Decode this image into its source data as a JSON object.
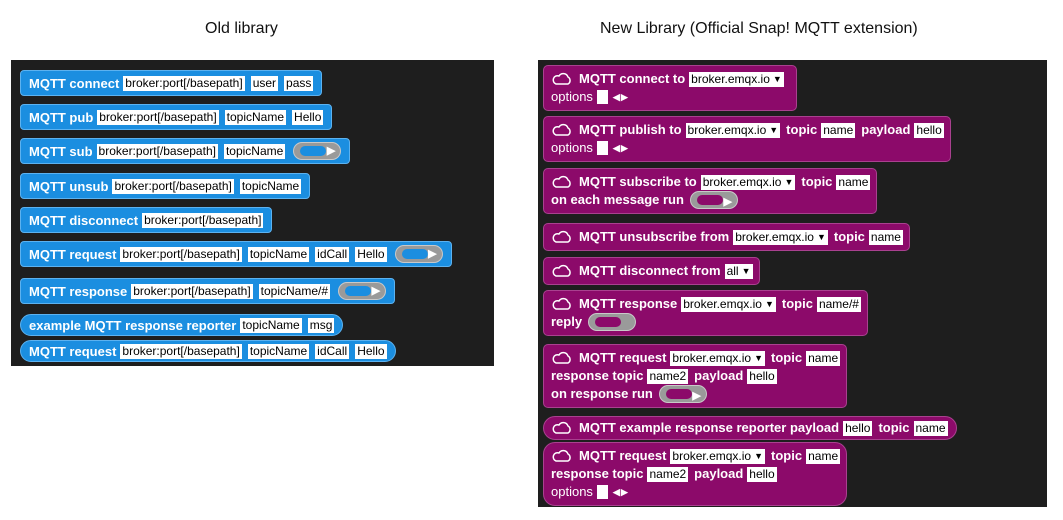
{
  "headings": {
    "old": "Old library",
    "new": "New Library (Official Snap! MQTT extension)"
  },
  "old": {
    "connect": {
      "label": "MQTT connect",
      "broker": "broker:port[/basepath]",
      "user": "user",
      "pass": "pass"
    },
    "pub": {
      "label": "MQTT pub",
      "broker": "broker:port[/basepath]",
      "topic": "topicName",
      "payload": "Hello"
    },
    "sub": {
      "label": "MQTT sub",
      "broker": "broker:port[/basepath]",
      "topic": "topicName"
    },
    "unsub": {
      "label": "MQTT unsub",
      "broker": "broker:port[/basepath]",
      "topic": "topicName"
    },
    "disconnect": {
      "label": "MQTT disconnect",
      "broker": "broker:port[/basepath]"
    },
    "request": {
      "label": "MQTT request",
      "broker": "broker:port[/basepath]",
      "topic": "topicName",
      "id": "idCall",
      "payload": "Hello"
    },
    "response": {
      "label": "MQTT response",
      "broker": "broker:port[/basepath]",
      "topic": "topicName/#"
    },
    "example": {
      "label": "example MQTT response reporter",
      "topic": "topicName",
      "msg": "msg"
    },
    "request_rep": {
      "label": "MQTT request",
      "broker": "broker:port[/basepath]",
      "topic": "topicName",
      "id": "idCall",
      "payload": "Hello"
    }
  },
  "new": {
    "options": "options",
    "connect": {
      "label": "MQTT connect to",
      "broker": "broker.emqx.io"
    },
    "publish": {
      "label": "MQTT publish to",
      "broker": "broker.emqx.io",
      "topic_kw": "topic",
      "topic": "name",
      "payload_kw": "payload",
      "payload": "hello"
    },
    "subscribe": {
      "label": "MQTT subscribe to",
      "broker": "broker.emqx.io",
      "topic_kw": "topic",
      "topic": "name",
      "line2": "on each message run"
    },
    "unsubscribe": {
      "label": "MQTT unsubscribe from",
      "broker": "broker.emqx.io",
      "topic_kw": "topic",
      "topic": "name"
    },
    "disconnect": {
      "label": "MQTT disconnect from",
      "target": "all"
    },
    "response": {
      "label": "MQTT response",
      "broker": "broker.emqx.io",
      "topic_kw": "topic",
      "topic": "name/#",
      "line2": "reply"
    },
    "request": {
      "label": "MQTT request",
      "broker": "broker.emqx.io",
      "topic_kw": "topic",
      "topic": "name",
      "resp_kw": "response topic",
      "resp_topic": "name2",
      "payload_kw": "payload",
      "payload": "hello",
      "line3": "on response run"
    },
    "example": {
      "label": "MQTT example response reporter payload",
      "payload": "hello",
      "topic_kw": "topic",
      "topic": "name"
    },
    "request_rep": {
      "label": "MQTT request",
      "broker": "broker.emqx.io",
      "topic_kw": "topic",
      "topic": "name",
      "resp_kw": "response topic",
      "resp_topic": "name2",
      "payload_kw": "payload",
      "payload": "hello"
    }
  },
  "icons": {
    "cloud": "cloud-icon",
    "ring": "ring-slot-icon",
    "dropdown": "dropdown-arrow-icon",
    "arrows": "variadic-arrows-icon"
  },
  "colors": {
    "old_block": "#1b8ee0",
    "new_block": "#8c0a6a",
    "panel": "#1e1e1e"
  }
}
